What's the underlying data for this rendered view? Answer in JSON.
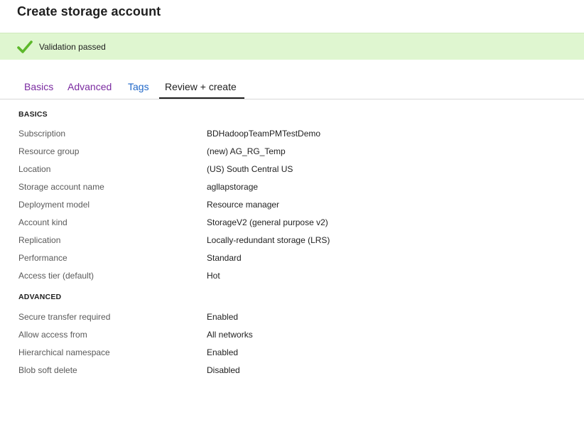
{
  "header": {
    "title": "Create storage account"
  },
  "validation": {
    "message": "Validation passed",
    "icon": "checkmark-icon",
    "color": "#5cb82a",
    "background": "#dff6d0"
  },
  "tabs": [
    {
      "label": "Basics",
      "color": "#7a2aa0"
    },
    {
      "label": "Advanced",
      "color": "#7a2aa0"
    },
    {
      "label": "Tags",
      "color": "#1f67c8"
    },
    {
      "label": "Review + create",
      "active": true
    }
  ],
  "sections": [
    {
      "title": "BASICS",
      "rows": [
        {
          "label": "Subscription",
          "value": "BDHadoopTeamPMTestDemo"
        },
        {
          "label": "Resource group",
          "value": "(new) AG_RG_Temp"
        },
        {
          "label": "Location",
          "value": "(US) South Central US"
        },
        {
          "label": "Storage account name",
          "value": "agllapstorage"
        },
        {
          "label": "Deployment model",
          "value": "Resource manager"
        },
        {
          "label": "Account kind",
          "value": "StorageV2 (general purpose v2)"
        },
        {
          "label": "Replication",
          "value": "Locally-redundant storage (LRS)"
        },
        {
          "label": "Performance",
          "value": "Standard"
        },
        {
          "label": "Access tier (default)",
          "value": "Hot"
        }
      ]
    },
    {
      "title": "ADVANCED",
      "rows": [
        {
          "label": "Secure transfer required",
          "value": "Enabled"
        },
        {
          "label": "Allow access from",
          "value": "All networks"
        },
        {
          "label": "Hierarchical namespace",
          "value": "Enabled"
        },
        {
          "label": "Blob soft delete",
          "value": "Disabled"
        }
      ]
    }
  ]
}
